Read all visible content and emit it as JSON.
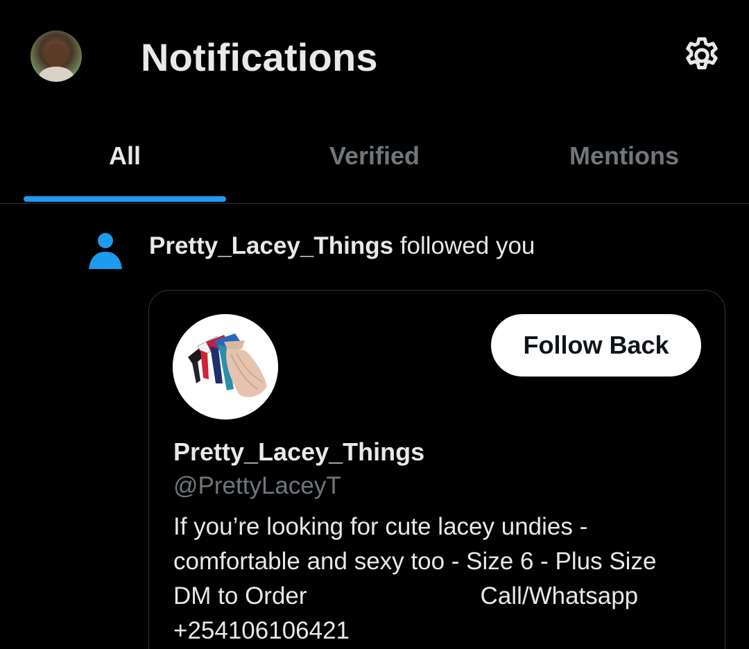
{
  "header": {
    "title": "Notifications",
    "settings_icon": "gear-icon"
  },
  "tabs": [
    {
      "label": "All",
      "active": true
    },
    {
      "label": "Verified",
      "active": false
    },
    {
      "label": "Mentions",
      "active": false
    }
  ],
  "notification": {
    "icon": "person-icon",
    "username": "Pretty_Lacey_Things",
    "action": " followed you"
  },
  "card": {
    "follow_button_label": "Follow Back",
    "display_name": "Pretty_Lacey_Things",
    "handle": "@PrettyLaceyT",
    "bio_lines": [
      "If you’re looking for cute lacey undies -",
      "comfortable and sexy too - Size 6 - Plus Size",
      "DM to Order",
      "Call/Whatsapp",
      "+254106106421"
    ]
  },
  "colors": {
    "background": "#000000",
    "accent": "#1d9bf0",
    "text_primary": "#e7e9ea",
    "text_secondary": "#71767b",
    "divider": "#2f3336"
  }
}
